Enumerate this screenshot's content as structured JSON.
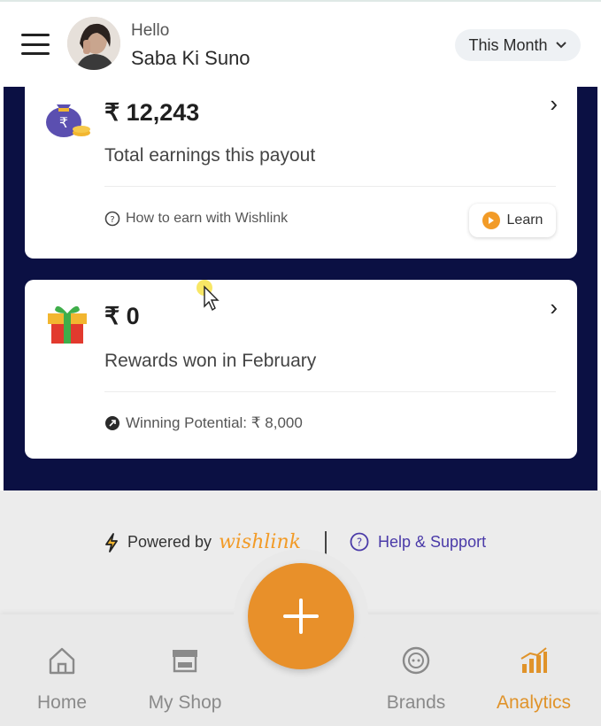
{
  "header": {
    "greeting": "Hello",
    "user_name": "Saba Ki Suno",
    "period_selector": "This Month"
  },
  "earnings_card": {
    "amount": "₹ 12,243",
    "description": "Total earnings this payout",
    "footer_text": "How to earn with Wishlink",
    "learn_label": "Learn"
  },
  "rewards_card": {
    "amount": "₹ 0",
    "description": "Rewards won in February",
    "footer_text": "Winning Potential: ₹ 8,000"
  },
  "footer": {
    "powered_by": "Powered by",
    "brand": "wishlink",
    "help": "Help & Support"
  },
  "bottom_nav": {
    "items": [
      {
        "label": "Home",
        "icon": "home-icon"
      },
      {
        "label": "My Shop",
        "icon": "shop-icon"
      },
      {
        "label": "Brands",
        "icon": "brands-icon"
      },
      {
        "label": "Analytics",
        "icon": "analytics-icon"
      }
    ],
    "active": "Analytics",
    "fab_icon": "plus-icon"
  },
  "colors": {
    "accent": "#e8902a",
    "dark_bg": "#0b1043",
    "help_link": "#4a3aa8"
  }
}
